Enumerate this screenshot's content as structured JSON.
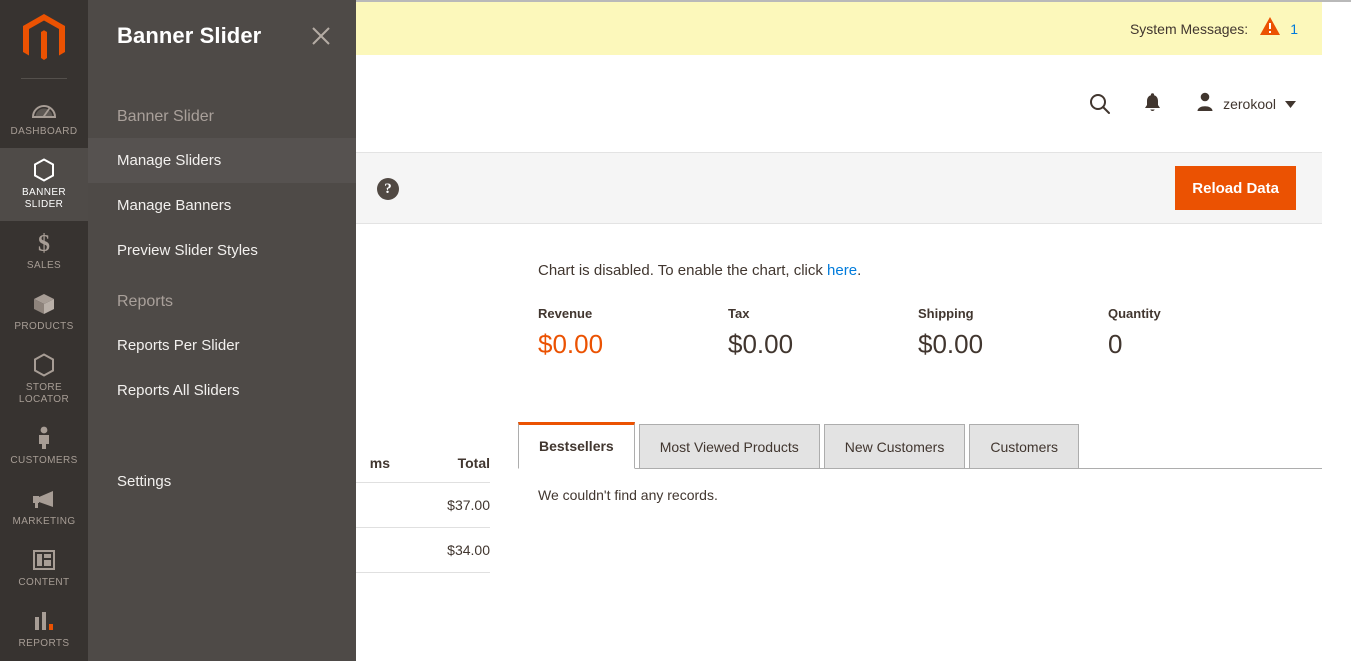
{
  "app": {
    "logo_name": "magento-logo",
    "accent_color": "#eb5202",
    "sidebar_bg": "#373330",
    "flyout_bg": "#4e4a47",
    "link_color": "#007bdb",
    "sysmsg_bg": "#fcf8bb"
  },
  "sidebar": {
    "items": [
      {
        "label": "Dashboard",
        "icon": "dashboard-gauge-icon",
        "active": false
      },
      {
        "label": "Banner Slider",
        "icon": "hexagon-icon",
        "active": true
      },
      {
        "label": "Sales",
        "icon": "dollar-icon",
        "active": false
      },
      {
        "label": "Products",
        "icon": "box-icon",
        "active": false
      },
      {
        "label": "Store Locator",
        "icon": "hexagon-icon",
        "active": false
      },
      {
        "label": "Customers",
        "icon": "person-icon",
        "active": false
      },
      {
        "label": "Marketing",
        "icon": "megaphone-icon",
        "active": false
      },
      {
        "label": "Content",
        "icon": "layout-icon",
        "active": false
      },
      {
        "label": "Reports",
        "icon": "bar-chart-icon",
        "active": false
      }
    ]
  },
  "flyout": {
    "title": "Banner Slider",
    "close_label": "close-flyout",
    "group_banner_slider": "Banner Slider",
    "items_banner": [
      {
        "label": "Manage Sliders",
        "current": true
      },
      {
        "label": "Manage Banners",
        "current": false
      },
      {
        "label": "Preview Slider Styles",
        "current": false
      }
    ],
    "group_reports": "Reports",
    "items_reports": [
      {
        "label": "Reports Per Slider",
        "current": false
      },
      {
        "label": "Reports All Sliders",
        "current": false
      }
    ],
    "settings_label": "Settings"
  },
  "system_messages": {
    "label": "System Messages:",
    "count": "1",
    "icon": "warning-triangle-icon"
  },
  "header": {
    "search_icon": "search-icon",
    "notifications_icon": "bell-icon",
    "user_icon": "user-avatar-icon",
    "user_name": "zerokool",
    "caret_icon": "chevron-down-icon"
  },
  "page_actions": {
    "help_icon": "question-mark-icon",
    "help_glyph": "?",
    "reload_label": "Reload Data"
  },
  "dashboard": {
    "chart_note_prefix": "Chart is disabled. To enable the chart, click ",
    "chart_note_link": "here",
    "chart_note_suffix": ".",
    "totals": [
      {
        "label": "Revenue",
        "value": "$0.00",
        "accent": true
      },
      {
        "label": "Tax",
        "value": "$0.00",
        "accent": false
      },
      {
        "label": "Shipping",
        "value": "$0.00",
        "accent": false
      },
      {
        "label": "Quantity",
        "value": "0",
        "accent": false
      }
    ],
    "tabs": [
      {
        "label": "Bestsellers",
        "active": true
      },
      {
        "label": "Most Viewed Products",
        "active": false
      },
      {
        "label": "New Customers",
        "active": false
      },
      {
        "label": "Customers",
        "active": false
      }
    ],
    "empty_message": "We couldn't find any records."
  },
  "background_table": {
    "col_items": "ms",
    "col_total": "Total",
    "rows": [
      {
        "total": "$37.00"
      },
      {
        "total": "$34.00"
      }
    ]
  }
}
